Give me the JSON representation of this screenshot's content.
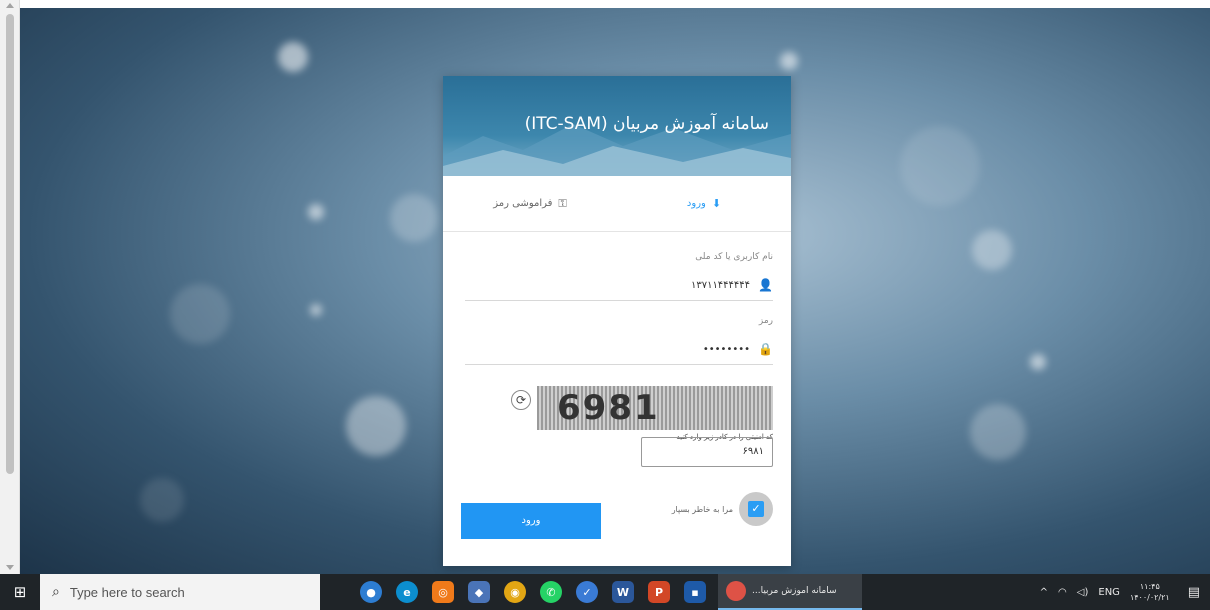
{
  "login": {
    "title": "سامانه آموزش مربیان (ITC-SAM)",
    "tabs": [
      {
        "label": "ورود",
        "icon": "login-icon",
        "active": true
      },
      {
        "label": "فراموشی رمز",
        "icon": "key-icon",
        "active": false
      }
    ],
    "username": {
      "label": "نام کاربری یا کد ملی",
      "value": "۱۳۷۱۱۴۴۴۴۴۴",
      "icon": "user-icon"
    },
    "password": {
      "label": "رمز",
      "value": "••••••••",
      "icon": "lock-icon"
    },
    "captcha": {
      "image_text": "6981",
      "hint": "کد امنیتی را در کادر زیر وارد کنید",
      "input_value": "۶۹۸۱",
      "refresh_icon": "refresh-icon"
    },
    "remember": {
      "label": "مرا به خاطر بسپار",
      "checked": true
    },
    "submit_label": "ورود"
  },
  "taskbar": {
    "search_placeholder": "Type here to search",
    "active_window_title": "سامانه آموزش مربیا...",
    "tray": {
      "lang": "ENG",
      "time": "۱۱:۴۵",
      "date": "۱۴۰۰/۰۲/۲۱"
    }
  },
  "colors": {
    "accent": "#2196f3",
    "header": "#2a6f97",
    "taskbar": "#1f2428"
  }
}
